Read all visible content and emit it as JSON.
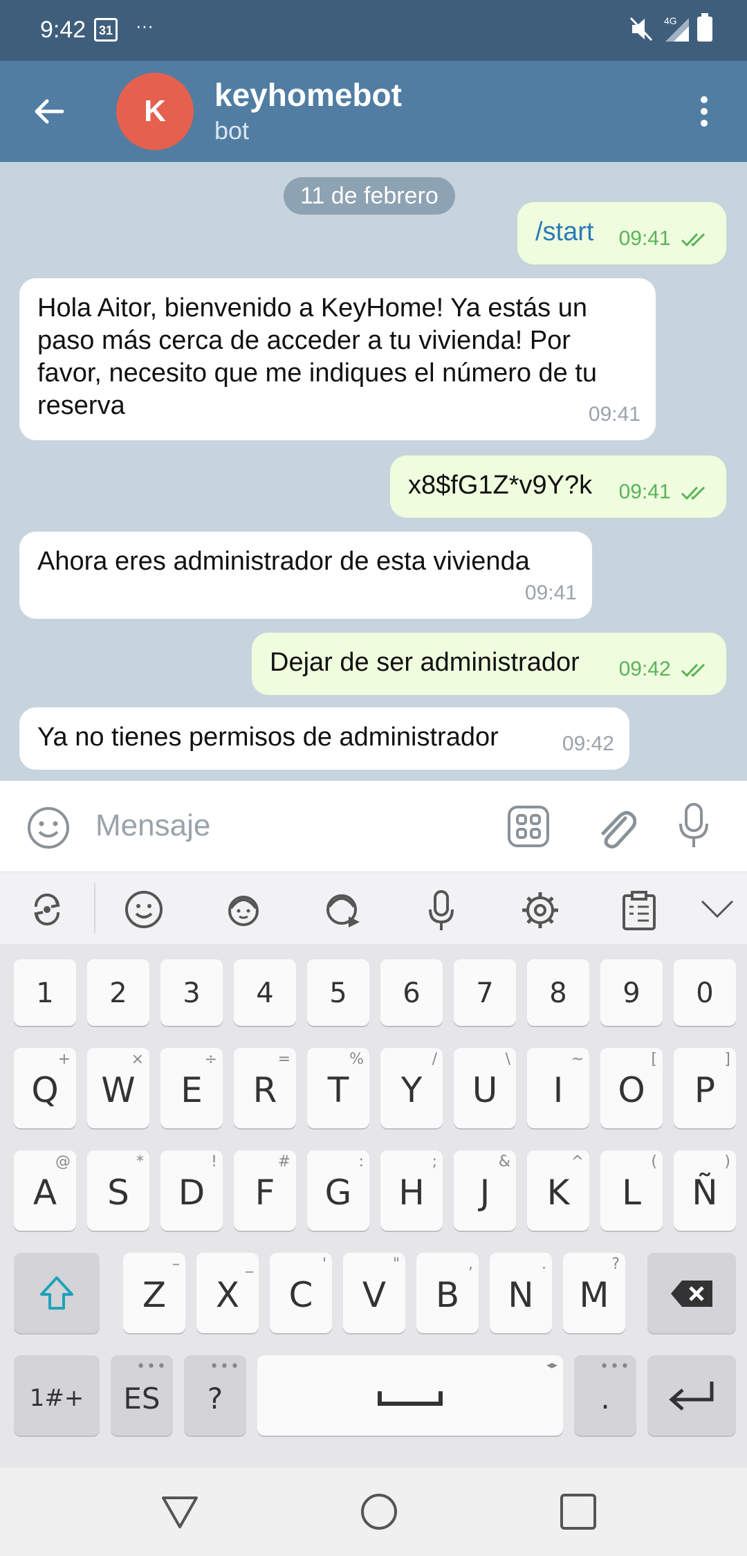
{
  "status_bar": {
    "time": "9:42",
    "calendar_day": "31",
    "more": "···",
    "network": "4G"
  },
  "app_bar": {
    "avatar_letter": "K",
    "avatar_color": "#e5604e",
    "title": "keyhomebot",
    "subtitle": "bot"
  },
  "chat": {
    "date_label": "11 de febrero",
    "messages": [
      {
        "direction": "out",
        "text": "/start",
        "time": "09:41",
        "read": true
      },
      {
        "direction": "in",
        "text": "Hola Aitor, bienvenido a KeyHome! Ya estás un paso más cerca de acceder a tu vivienda! Por favor, necesito que me indiques el número de tu reserva",
        "time": "09:41"
      },
      {
        "direction": "out",
        "text": "x8$fG1Z*v9Y?k",
        "time": "09:41",
        "read": true
      },
      {
        "direction": "in",
        "text": "Ahora eres administrador de esta vivienda",
        "time": "09:41"
      },
      {
        "direction": "out",
        "text": "Dejar de ser administrador",
        "time": "09:42",
        "read": true
      },
      {
        "direction": "in",
        "text": "Ya no tienes permisos de administrador",
        "time": "09:42"
      }
    ]
  },
  "input_bar": {
    "placeholder": "Mensaje"
  },
  "keyboard": {
    "number_row": [
      "1",
      "2",
      "3",
      "4",
      "5",
      "6",
      "7",
      "8",
      "9",
      "0"
    ],
    "row1": [
      {
        "label": "Q",
        "hint": "+"
      },
      {
        "label": "W",
        "hint": "×"
      },
      {
        "label": "E",
        "hint": "÷"
      },
      {
        "label": "R",
        "hint": "="
      },
      {
        "label": "T",
        "hint": "%"
      },
      {
        "label": "Y",
        "hint": "/"
      },
      {
        "label": "U",
        "hint": "\\"
      },
      {
        "label": "I",
        "hint": "~"
      },
      {
        "label": "O",
        "hint": "["
      },
      {
        "label": "P",
        "hint": "]"
      }
    ],
    "row2": [
      {
        "label": "A",
        "hint": "@"
      },
      {
        "label": "S",
        "hint": "*"
      },
      {
        "label": "D",
        "hint": "!"
      },
      {
        "label": "F",
        "hint": "#"
      },
      {
        "label": "G",
        "hint": ":"
      },
      {
        "label": "H",
        "hint": ";"
      },
      {
        "label": "J",
        "hint": "&"
      },
      {
        "label": "K",
        "hint": "^"
      },
      {
        "label": "L",
        "hint": "("
      },
      {
        "label": "Ñ",
        "hint": ")"
      }
    ],
    "row3": [
      {
        "label": "Z",
        "hint": "–"
      },
      {
        "label": "X",
        "hint": "_"
      },
      {
        "label": "C",
        "hint": "'"
      },
      {
        "label": "V",
        "hint": "\""
      },
      {
        "label": "B",
        "hint": ","
      },
      {
        "label": "N",
        "hint": "."
      },
      {
        "label": "M",
        "hint": "?"
      }
    ],
    "symbols_key": "1#+",
    "lang_key": "ES",
    "question_key": "?",
    "period_key": "."
  },
  "colors": {
    "status_bar": "#3f5e7c",
    "app_bar": "#517da2",
    "chat_bg": "#c7d4dd",
    "incoming": "#ffffff",
    "outgoing": "#effdde",
    "time_outgoing": "#59b35a",
    "command_link": "#2a7ab8"
  }
}
